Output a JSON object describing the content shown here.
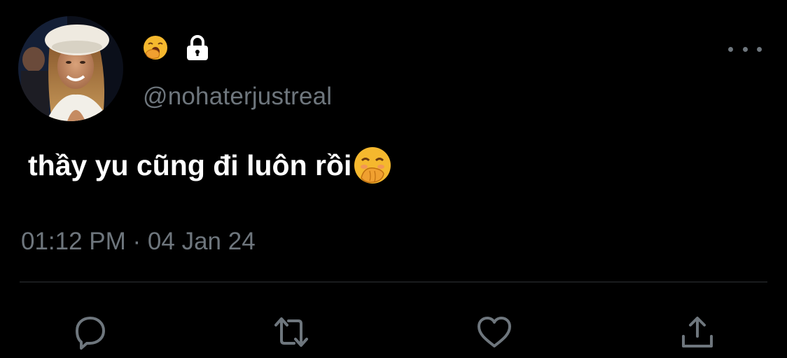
{
  "tweet": {
    "author": {
      "handle": "@nohaterjustreal",
      "avatar_icon": "profile-photo-woman-beret",
      "name_emoji_icon": "yawning-face-emoji",
      "protected_icon": "lock-icon"
    },
    "text": "thầy yu cũng đi luôn rồi",
    "text_emoji_icon": "face-with-hand-over-mouth-emoji",
    "timestamp": "01:12 PM · 04 Jan 24"
  },
  "actions": {
    "reply_icon": "reply-icon",
    "retweet_icon": "retweet-icon",
    "like_icon": "heart-icon",
    "share_icon": "share-icon",
    "more_icon": "more-options-icon"
  },
  "colors": {
    "background": "#000000",
    "text_primary": "#ffffff",
    "text_secondary": "#6e767d",
    "divider": "#2f3336"
  }
}
